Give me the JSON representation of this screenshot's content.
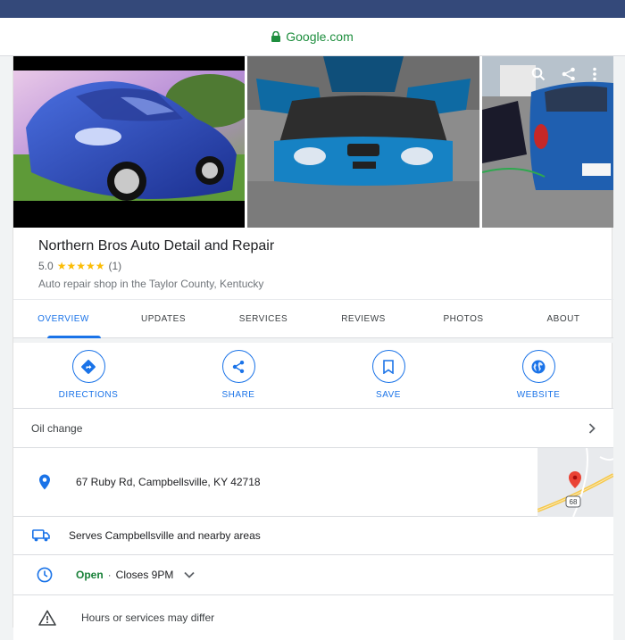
{
  "browser": {
    "url": "Google.com"
  },
  "gallery": {
    "photos": [
      {
        "name": "car-side-photo"
      },
      {
        "name": "engine-bay-photo"
      },
      {
        "name": "car-rear-photo"
      }
    ],
    "icons": [
      "search-icon",
      "share-icon",
      "more-vert-icon"
    ]
  },
  "business": {
    "name": "Northern Bros Auto Detail and Repair",
    "rating": "5.0",
    "stars": "★★★★★",
    "review_count": "(1)",
    "category": "Auto repair shop in the Taylor County, Kentucky"
  },
  "tabs": [
    {
      "label": "OVERVIEW",
      "active": true
    },
    {
      "label": "UPDATES"
    },
    {
      "label": "SERVICES"
    },
    {
      "label": "REVIEWS"
    },
    {
      "label": "PHOTOS"
    },
    {
      "label": "ABOUT"
    }
  ],
  "actions": [
    {
      "label": "DIRECTIONS",
      "icon": "directions-icon"
    },
    {
      "label": "SHARE",
      "icon": "share-icon"
    },
    {
      "label": "SAVE",
      "icon": "bookmark-icon"
    },
    {
      "label": "WEBSITE",
      "icon": "globe-icon"
    }
  ],
  "info": {
    "service_link": "Oil change",
    "address": "67 Ruby Rd, Campbellsville, KY 42718",
    "map_route": "68",
    "serves": "Serves Campbellsville and nearby areas",
    "hours_status": "Open",
    "hours_separator": "·",
    "hours_close": "Closes 9PM",
    "warning": "Hours or services may differ"
  },
  "colors": {
    "accent": "#1a73e8",
    "open_green": "#188038",
    "star": "#fbbc04",
    "status_bar": "#34497a",
    "url_green": "#1e8e3e"
  }
}
